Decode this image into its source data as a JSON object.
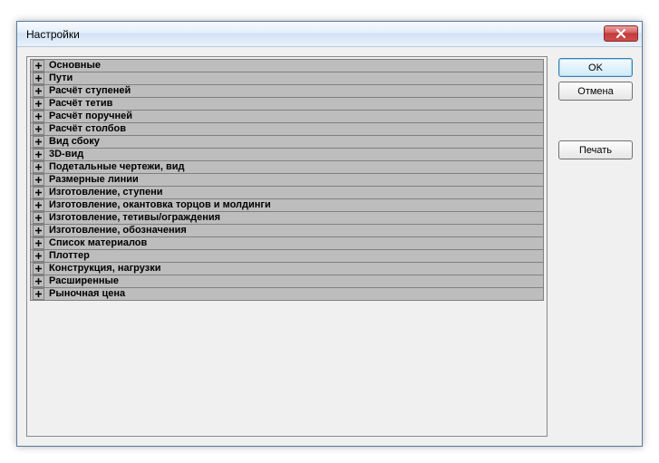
{
  "window": {
    "title": "Настройки"
  },
  "buttons": {
    "ok": "OK",
    "cancel": "Отмена",
    "print": "Печать"
  },
  "categories": [
    "Основные",
    "Пути",
    "Расчёт ступеней",
    "Расчёт тетив",
    "Расчёт поручней",
    "Расчёт столбов",
    "Вид сбоку",
    "3D-вид",
    "Подетальные чертежи, вид",
    "Размерные линии",
    "Изготовление, ступени",
    "Изготовление, окантовка торцов и молдинги",
    "Изготовление, тетивы/ограждения",
    "Изготовление, обозначения",
    "Список материалов",
    "Плоттер",
    "Конструкция, нагрузки",
    "Расширенные",
    "Рыночная цена"
  ]
}
